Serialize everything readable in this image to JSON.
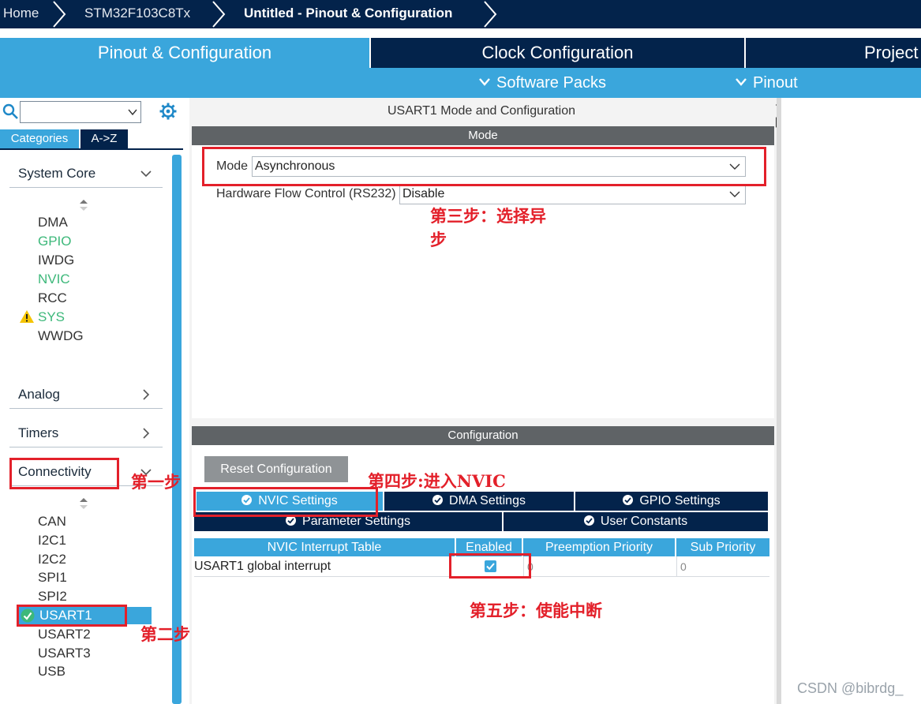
{
  "breadcrumb": {
    "items": [
      "Home",
      "STM32F103C8Tx",
      "Untitled - Pinout & Configuration"
    ]
  },
  "main_tabs": [
    {
      "label": "Pinout & Configuration",
      "active": true
    },
    {
      "label": "Clock Configuration",
      "active": false
    },
    {
      "label": "Project",
      "active": false
    }
  ],
  "sub_bar": {
    "software_packs": "Software Packs",
    "pinout": "Pinout"
  },
  "left_panel": {
    "search": {
      "value": "",
      "placeholder": ""
    },
    "tabs": [
      "Categories",
      "A->Z"
    ],
    "groups": {
      "system_core": "System Core",
      "analog": "Analog",
      "timers": "Timers",
      "connectivity": "Connectivity"
    },
    "system_core_items": [
      "DMA",
      "GPIO",
      "IWDG",
      "NVIC",
      "RCC",
      "SYS",
      "WWDG"
    ],
    "connectivity_items": [
      "CAN",
      "I2C1",
      "I2C2",
      "SPI1",
      "SPI2",
      "USART1",
      "USART2",
      "USART3",
      "USB"
    ]
  },
  "center": {
    "title": "USART1 Mode and Configuration",
    "mode_header": "Mode",
    "mode_label": "Mode",
    "mode_value": "Asynchronous",
    "hw_flow_label": "Hardware Flow Control (RS232)",
    "hw_flow_value": "Disable",
    "config_header": "Configuration",
    "reset_button": "Reset Configuration",
    "settings_tabs": {
      "nvic": "NVIC Settings",
      "dma": "DMA Settings",
      "gpio": "GPIO Settings",
      "parameter": "Parameter Settings",
      "user_constants": "User Constants"
    },
    "table": {
      "headers": [
        "NVIC Interrupt Table",
        "Enabled",
        "Preemption Priority",
        "Sub Priority"
      ],
      "rows": [
        {
          "name": "USART1 global interrupt",
          "enabled": true,
          "preemption": "0",
          "sub": "0"
        }
      ]
    }
  },
  "annotations": {
    "step1": "第一步",
    "step2": "第二步",
    "step3_line1": "第三步：选择异",
    "step3_line2": "步",
    "step4": "第四步:进入NVIC",
    "step5": "第五步：使能中断"
  },
  "watermark": "CSDN @bibrdg_",
  "colors": {
    "navy": "#03234b",
    "blue": "#3aa6dc",
    "green": "#3db87a",
    "red": "#e3202a",
    "header_gray": "#5f6366"
  }
}
